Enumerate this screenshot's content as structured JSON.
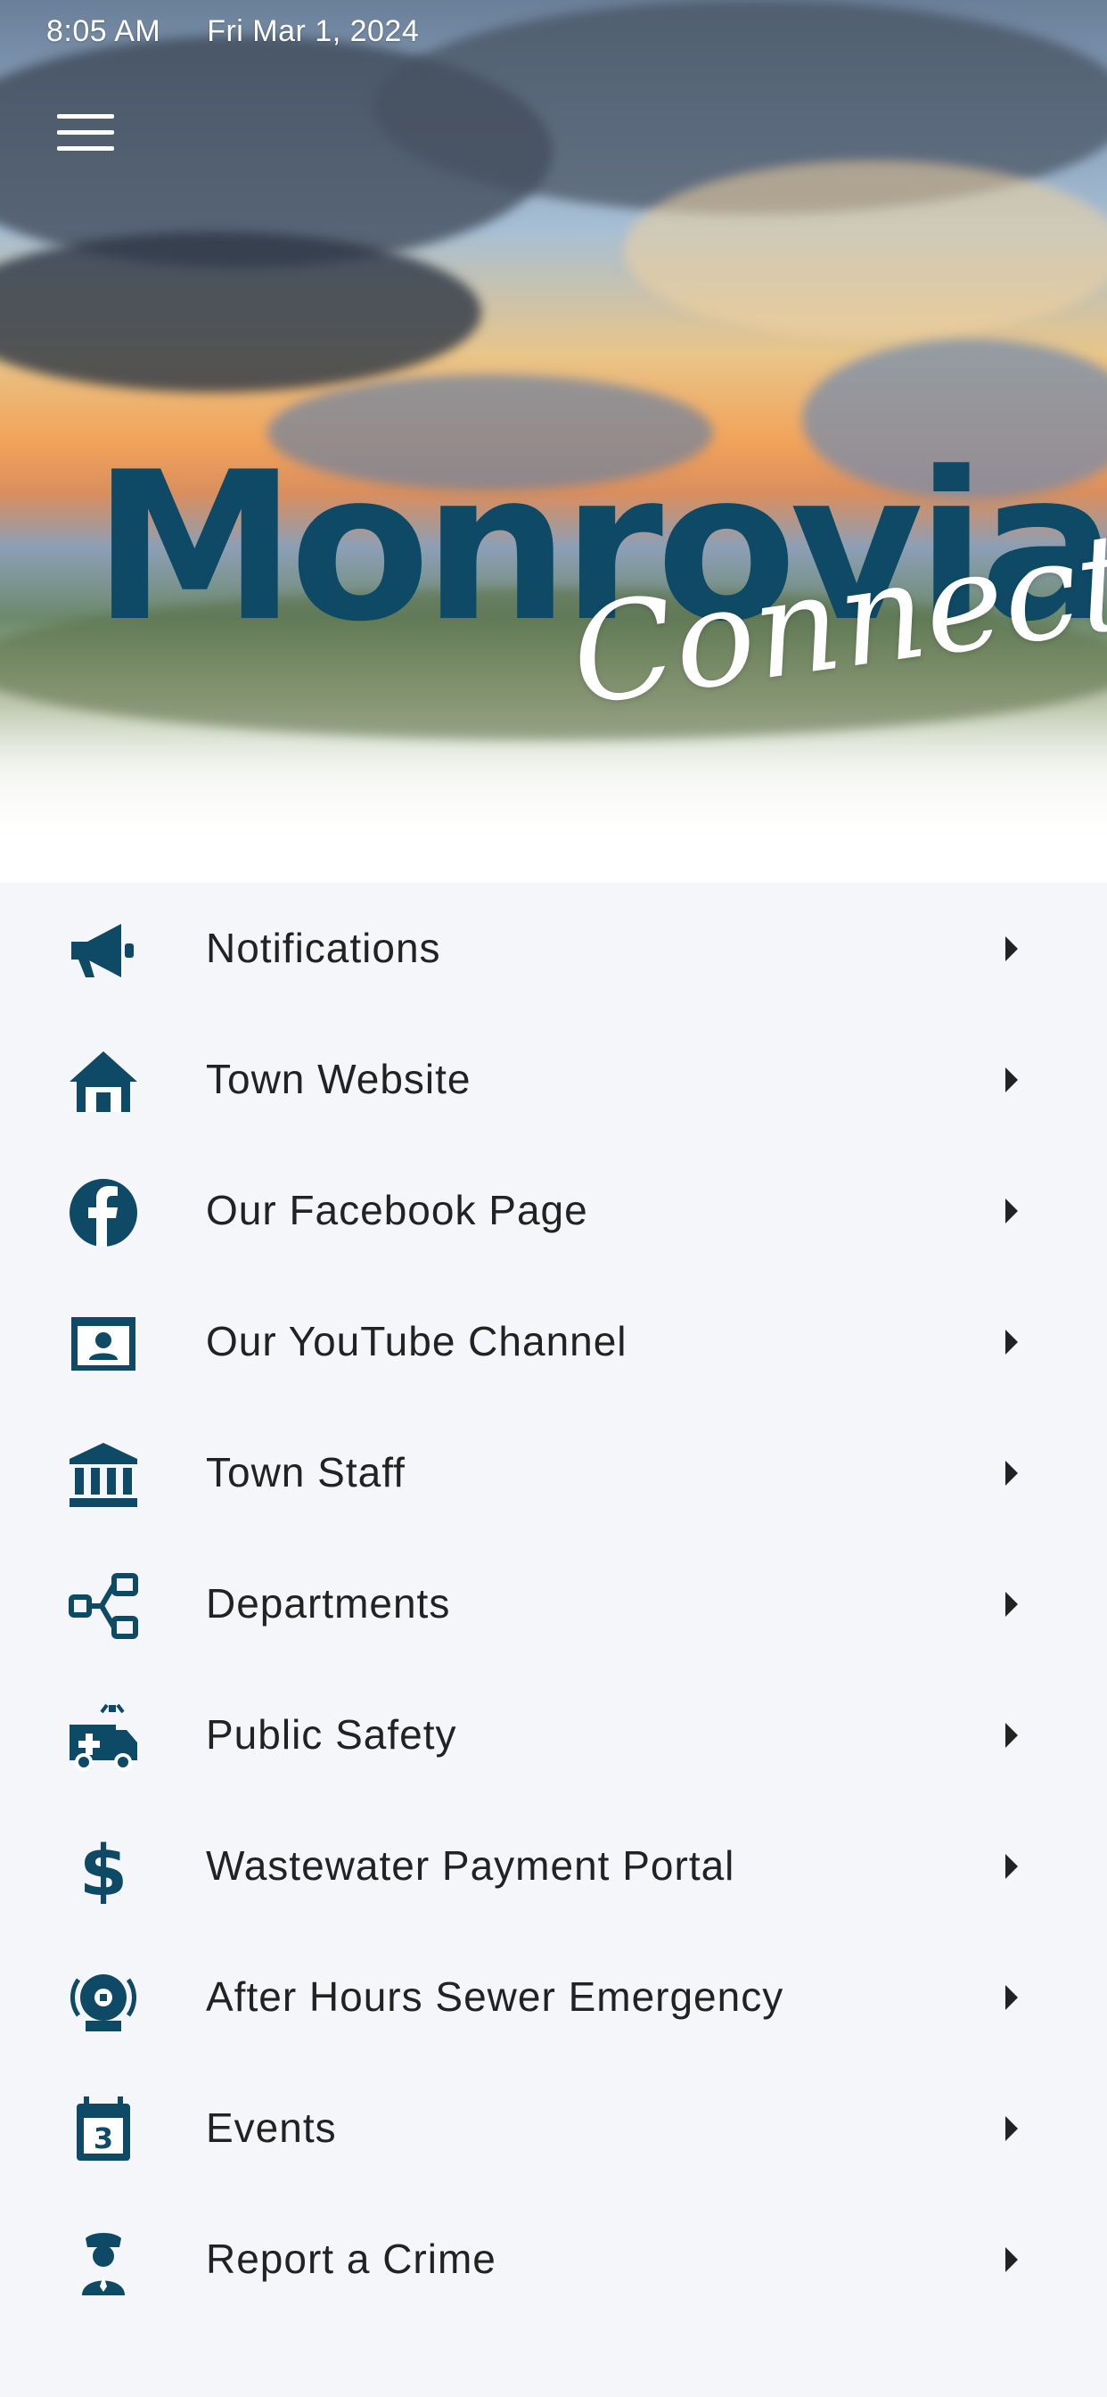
{
  "status_bar": {
    "time": "8:05 AM",
    "date": "Fri Mar 1, 2024"
  },
  "header": {
    "menu_icon": "hamburger-menu-icon",
    "logo_main": "Monrovia",
    "logo_script": "Connect"
  },
  "colors": {
    "icon": "#0e4a66",
    "text": "#222222",
    "list_bg": "#f4f6f9",
    "logo": "#0e4a66"
  },
  "menu": {
    "items": [
      {
        "label": "Notifications",
        "icon": "megaphone-icon"
      },
      {
        "label": "Town Website",
        "icon": "house-icon"
      },
      {
        "label": "Our Facebook Page",
        "icon": "facebook-icon"
      },
      {
        "label": "Our YouTube Channel",
        "icon": "video-user-icon"
      },
      {
        "label": "Town Staff",
        "icon": "government-building-icon"
      },
      {
        "label": "Departments",
        "icon": "org-chart-icon"
      },
      {
        "label": "Public Safety",
        "icon": "ambulance-icon"
      },
      {
        "label": "Wastewater Payment Portal",
        "icon": "dollar-icon"
      },
      {
        "label": "After Hours Sewer Emergency",
        "icon": "alarm-bell-icon"
      },
      {
        "label": "Events",
        "icon": "calendar-icon"
      },
      {
        "label": "Report a Crime",
        "icon": "police-officer-icon"
      }
    ]
  }
}
